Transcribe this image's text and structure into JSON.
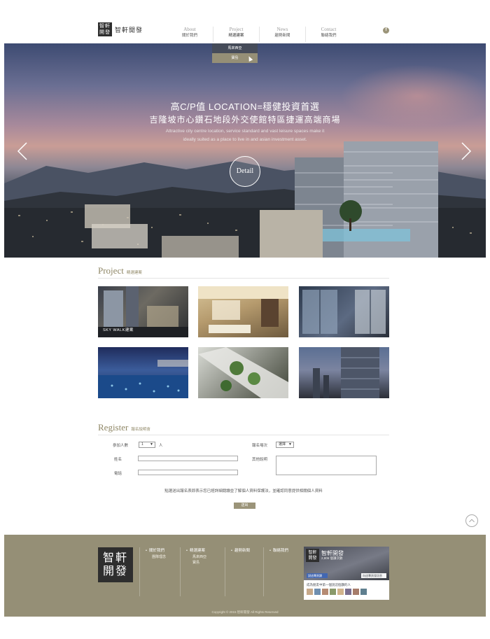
{
  "header": {
    "logo_mark": "智軒\n開發",
    "logo_text": "智軒開發",
    "fb_icon": "f"
  },
  "nav": [
    {
      "en": "About",
      "zh": "關於我們"
    },
    {
      "en": "Project",
      "zh": "精選建案"
    },
    {
      "en": "News",
      "zh": "趨勢新聞"
    },
    {
      "en": "Contact",
      "zh": "聯絡我們"
    }
  ],
  "dropdown": {
    "items": [
      "馬來西亞",
      "寶島"
    ]
  },
  "hero": {
    "line1": "高C/P值 LOCATION=穩健投資首選",
    "line2": "吉隆坡市心鑽石地段外交使館特區捷運高端商場",
    "en_line1": "Attractive city centre location, service standard and vast leisure spaces make it",
    "en_line2": "ideally suited as a place to live in and asian investment asset.",
    "detail_label": "Detail",
    "icons": {
      "prev": "chevron-left-icon",
      "next": "chevron-right-icon"
    }
  },
  "project": {
    "title": "Project",
    "subtitle": "精選建案",
    "tiles": [
      {
        "label": "SKY WALK建案"
      },
      {
        "label": ""
      },
      {
        "label": ""
      },
      {
        "label": ""
      },
      {
        "label": ""
      },
      {
        "label": ""
      }
    ]
  },
  "register": {
    "title": "Register",
    "subtitle": "報名說明會",
    "people_label": "參加人數",
    "people_value": "1",
    "people_unit": "人",
    "session_label": "報名場次",
    "session_value": "選擇",
    "name_label": "姓名",
    "phone_label": "電話",
    "other_label": "其他說明",
    "notice": "點選送出報名表即表示您已經詳細閱讀並了解個人資料保護法，並確認同意提供相關個人資料",
    "submit_label": "送出"
  },
  "footer": {
    "logo": "智軒\n開發",
    "columns": [
      {
        "head": "關於我們",
        "subs": [
          "團隊理念"
        ]
      },
      {
        "head": "精選建案",
        "subs": [
          "馬來西亞",
          "寶島"
        ]
      },
      {
        "head": "趨勢新聞",
        "subs": []
      },
      {
        "head": "聯絡我們",
        "subs": []
      }
    ],
    "fb_widget": {
      "name": "智軒開發",
      "count": "2,806 個讚次數",
      "like_label": "說這專頁讚",
      "message_label": "向這專頁發訊息",
      "friends_text": "成為朋友中第一個說這個讚的人"
    },
    "copyright": "Copyright © 2015 智軒開發 All Rights Reserved"
  },
  "colors": {
    "accent": "#958f76",
    "heading": "#8f8766",
    "dark": "#2e2e2e"
  }
}
